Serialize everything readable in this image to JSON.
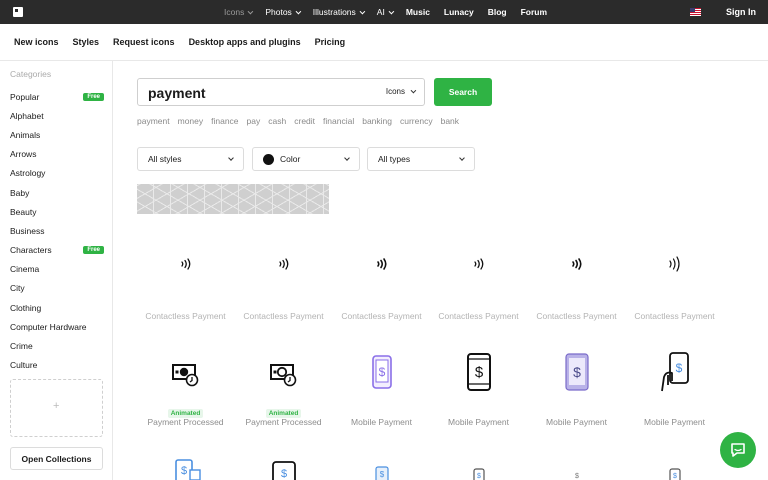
{
  "topbar": {
    "nav": [
      {
        "label": "Icons",
        "dim": true,
        "chevron": true
      },
      {
        "label": "Photos",
        "dim": false,
        "chevron": true
      },
      {
        "label": "Illustrations",
        "dim": false,
        "chevron": true
      },
      {
        "label": "AI",
        "dim": false,
        "chevron": true
      },
      {
        "label": "Music",
        "dim": false,
        "bold": true
      },
      {
        "label": "Lunacy",
        "dim": false,
        "bold": true
      },
      {
        "label": "Blog",
        "dim": false,
        "bold": true
      },
      {
        "label": "Forum",
        "dim": false,
        "bold": true
      }
    ],
    "signin": "Sign In"
  },
  "subnav": [
    "New icons",
    "Styles",
    "Request icons",
    "Desktop apps and plugins",
    "Pricing"
  ],
  "sidebar": {
    "title": "Categories",
    "items": [
      {
        "label": "Popular",
        "badge": "Free"
      },
      {
        "label": "Alphabet"
      },
      {
        "label": "Animals"
      },
      {
        "label": "Arrows"
      },
      {
        "label": "Astrology"
      },
      {
        "label": "Baby"
      },
      {
        "label": "Beauty"
      },
      {
        "label": "Business"
      },
      {
        "label": "Characters",
        "badge": "Free"
      },
      {
        "label": "Cinema"
      },
      {
        "label": "City"
      },
      {
        "label": "Clothing"
      },
      {
        "label": "Computer Hardware"
      },
      {
        "label": "Crime"
      },
      {
        "label": "Culture"
      }
    ],
    "drop_plus": "+",
    "open_collections": "Open Collections"
  },
  "search": {
    "value": "payment",
    "type": "Icons",
    "button": "Search",
    "tags": [
      "payment",
      "money",
      "finance",
      "pay",
      "cash",
      "credit",
      "financial",
      "banking",
      "currency",
      "bank"
    ]
  },
  "filters": {
    "styles": "All styles",
    "color": "Color",
    "types": "All types"
  },
  "results": {
    "row1": [
      "Contactless Payment",
      "Contactless Payment",
      "Contactless Payment",
      "Contactless Payment",
      "Contactless Payment",
      "Contactless Payment"
    ],
    "row2": [
      {
        "label": "Payment Processed",
        "badge": "Animated"
      },
      {
        "label": "Payment Processed",
        "badge": "Animated"
      },
      {
        "label": "Mobile Payment"
      },
      {
        "label": "Mobile Payment"
      },
      {
        "label": "Mobile Payment"
      },
      {
        "label": "Mobile Payment"
      }
    ]
  },
  "colors": {
    "brand": "#2fb344",
    "topbar": "#2b2b2b",
    "purple": "#8a6fe8",
    "blue": "#4a8fe0"
  }
}
